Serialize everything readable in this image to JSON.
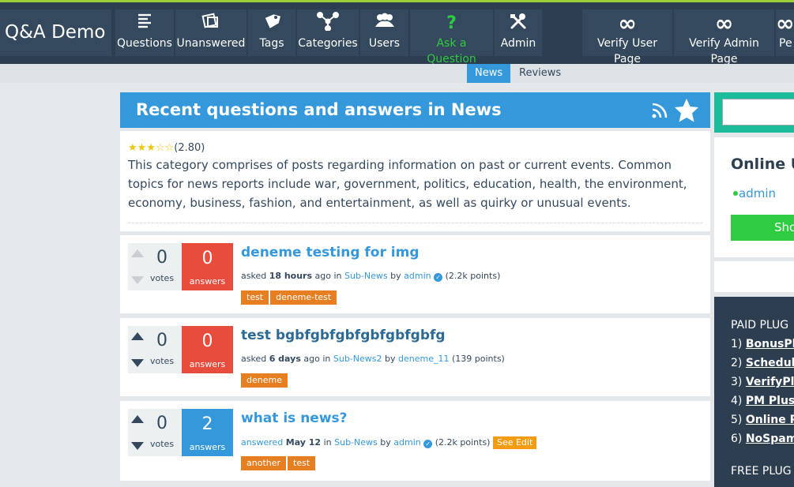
{
  "app": {
    "title": "Q&A Demo"
  },
  "nav": {
    "items": [
      {
        "label": "Questions",
        "icon": "list-icon"
      },
      {
        "label": "Unanswered",
        "icon": "square-icon"
      },
      {
        "label": "Tags",
        "icon": "tag-icon"
      },
      {
        "label": "Categories",
        "icon": "sitemap-icon"
      },
      {
        "label": "Users",
        "icon": "users-icon"
      },
      {
        "label": "Ask a Question",
        "icon": "question-icon"
      },
      {
        "label": "Admin",
        "icon": "tools-icon"
      },
      {
        "label": "Verify User Page",
        "icon": "infinity-icon"
      },
      {
        "label": "Verify Admin Page",
        "icon": "infinity-icon"
      },
      {
        "label": "Pe",
        "icon": "infinity-icon"
      }
    ],
    "ask_color": "#2ecc40"
  },
  "subnav": {
    "news": "News",
    "reviews": "Reviews"
  },
  "category": {
    "heading": "Recent questions and answers in News",
    "rating_value": "(2.80)",
    "rating_stars": "★★★☆☆",
    "description": "This category comprises of posts regarding information on past or current events. Common topics for news reports include war, government, politics, education, health, the environment, economy, business, fashion, and entertainment, as well as quirky or unusual events."
  },
  "questions": [
    {
      "title": "deneme testing for img",
      "votes": "0",
      "votes_label": "votes",
      "answers": "0",
      "answers_label": "answers",
      "meta_verb": "asked",
      "meta_when": "18 hours",
      "meta_ago": "ago in",
      "category": "Sub-News",
      "meta_by": "by",
      "user": "admin",
      "points": "(2.2k points)",
      "tags": [
        "test",
        "deneme-test"
      ]
    },
    {
      "title": "test bgbfgbfgbfgbfgbfgbfg",
      "votes": "0",
      "votes_label": "votes",
      "answers": "0",
      "answers_label": "answers",
      "meta_verb": "asked",
      "meta_when": "6 days",
      "meta_ago": "ago in",
      "category": "Sub-News2",
      "meta_by": "by",
      "user": "deneme_11",
      "points": "(139 points)",
      "tags": [
        "deneme"
      ]
    },
    {
      "title": "what is news?",
      "votes": "0",
      "votes_label": "votes",
      "answers": "2",
      "answers_label": "answers",
      "meta_verb": "answered",
      "meta_when": "May 12",
      "meta_ago": "in",
      "category": "Sub-News",
      "meta_by": "by",
      "user": "admin",
      "points": "(2.2k points)",
      "edit_label": "See Edit",
      "tags": [
        "another",
        "test"
      ]
    }
  ],
  "sidebar": {
    "online_title": "Online U",
    "online_user": "admin",
    "show_button": "Sho",
    "paid_title": "PAID PLUG",
    "paid_items": [
      {
        "num": "1)",
        "name": "BonusPl"
      },
      {
        "num": "2)",
        "name": "Schedule"
      },
      {
        "num": "3)",
        "name": "VerifyPl"
      },
      {
        "num": "4)",
        "name": "PM Plus"
      },
      {
        "num": "5)",
        "name": "Online P"
      },
      {
        "num": "6)",
        "name": "NoSpam"
      }
    ],
    "free_title": "FREE PLUG"
  },
  "colors": {
    "accent": "#3498db",
    "nav_bg": "#34495e",
    "danger": "#e74c3c",
    "tag": "#e67e22",
    "success": "#2ecc40"
  }
}
